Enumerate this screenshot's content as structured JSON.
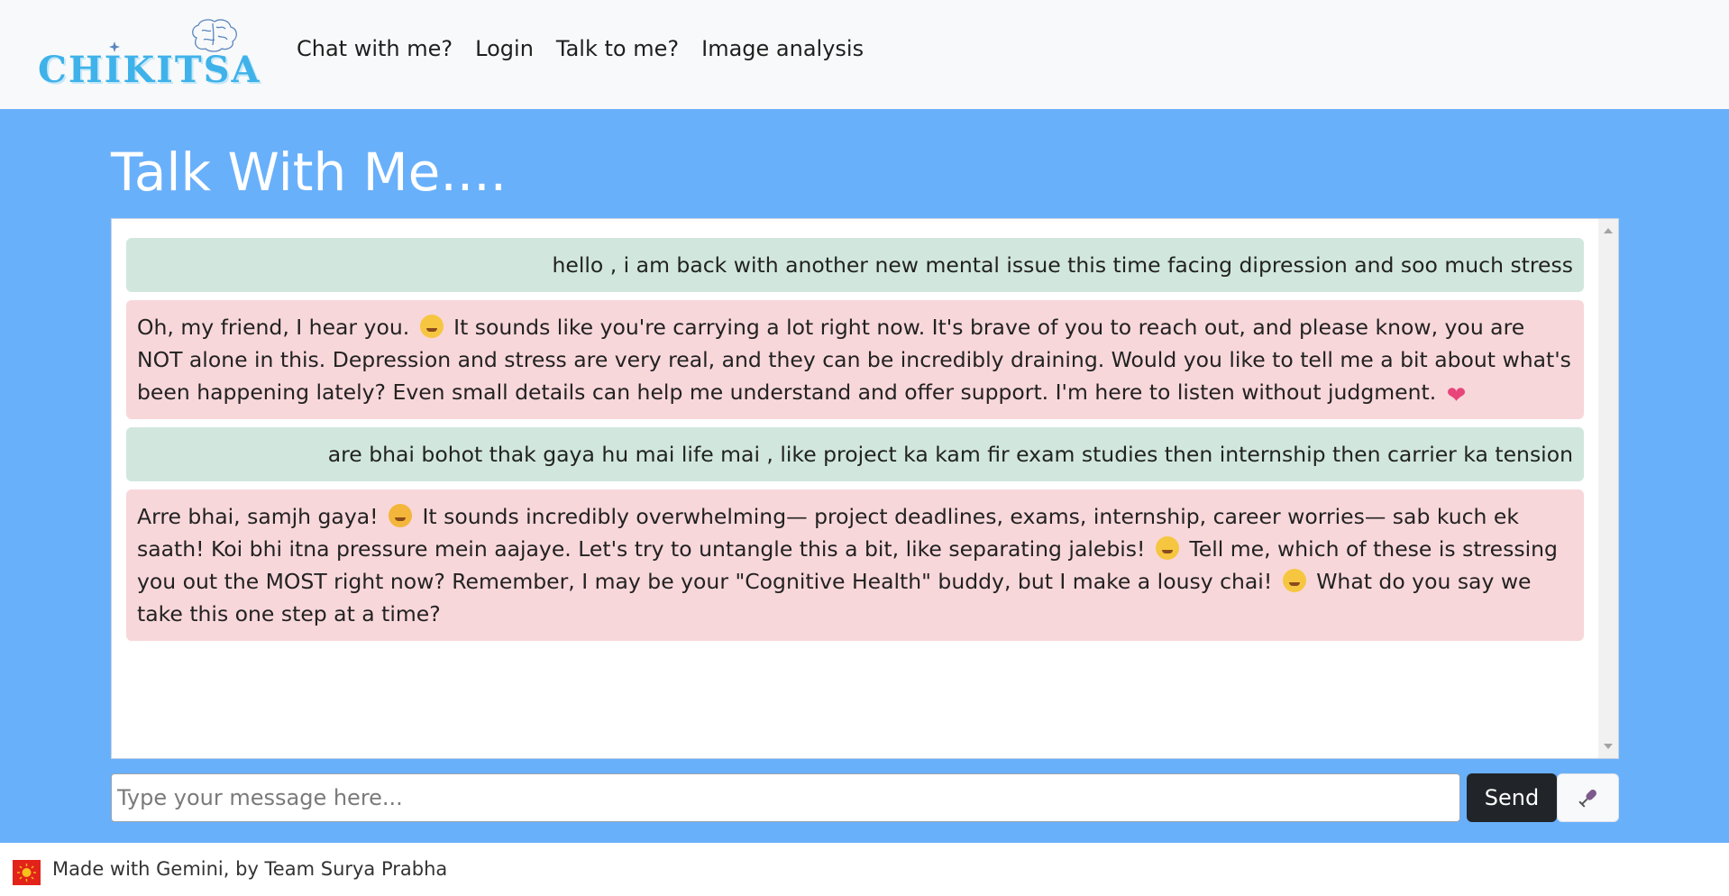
{
  "brand": {
    "name": "CHIKITSA",
    "logo_icon": "brain-icon"
  },
  "nav": {
    "items": [
      {
        "label": "Chat with me?"
      },
      {
        "label": "Login"
      },
      {
        "label": "Talk to me?"
      },
      {
        "label": "Image analysis"
      }
    ]
  },
  "page": {
    "title": "Talk With Me...."
  },
  "chat": {
    "messages": [
      {
        "role": "user",
        "text": "hello , i am back with another new mental issue this time facing dipression and soo much stress"
      },
      {
        "role": "bot",
        "parts": [
          "Oh, my friend, I hear you. ",
          " It sounds like you're carrying a lot right now. It's brave of you to reach out, and please know, you are NOT alone in this. Depression and stress are very real, and they can be incredibly draining. Would you like to tell me a bit about what's been happening lately? Even small details can help me understand and offer support. I'm here to listen without judgment. "
        ],
        "emojis": [
          "pensive-face-icon",
          "heart-icon"
        ]
      },
      {
        "role": "user",
        "text": "are bhai bohot thak gaya hu mai life mai , like project ka kam fir exam studies then internship then carrier ka tension"
      },
      {
        "role": "bot",
        "parts": [
          "Arre bhai, samjh gaya! ",
          " It sounds incredibly overwhelming— project deadlines, exams, internship, career worries— sab kuch ek saath! Koi bhi itna pressure mein aajaye. Let's try to untangle this a bit, like separating jalebis! ",
          " Tell me, which of these is stressing you out the MOST right now? Remember, I may be your \"Cognitive Health\" buddy, but I make a lousy chai! ",
          " What do you say we take this one step at a time?"
        ],
        "emojis": [
          "weary-face-icon",
          "winking-face-icon",
          "sweat-smile-icon"
        ]
      }
    ]
  },
  "input": {
    "placeholder": "Type your message here...",
    "value": "",
    "send_label": "Send",
    "mic_icon": "microphone-icon"
  },
  "footer": {
    "text": "Made with Gemini, by Team Surya Prabha",
    "flag_icon": "flag-icon"
  },
  "colors": {
    "main_bg": "#69b0fb",
    "user_bubble": "#d1e7dd",
    "bot_bubble": "#f8d7da",
    "send_button": "#212529",
    "brand": "#3fb2ea"
  }
}
